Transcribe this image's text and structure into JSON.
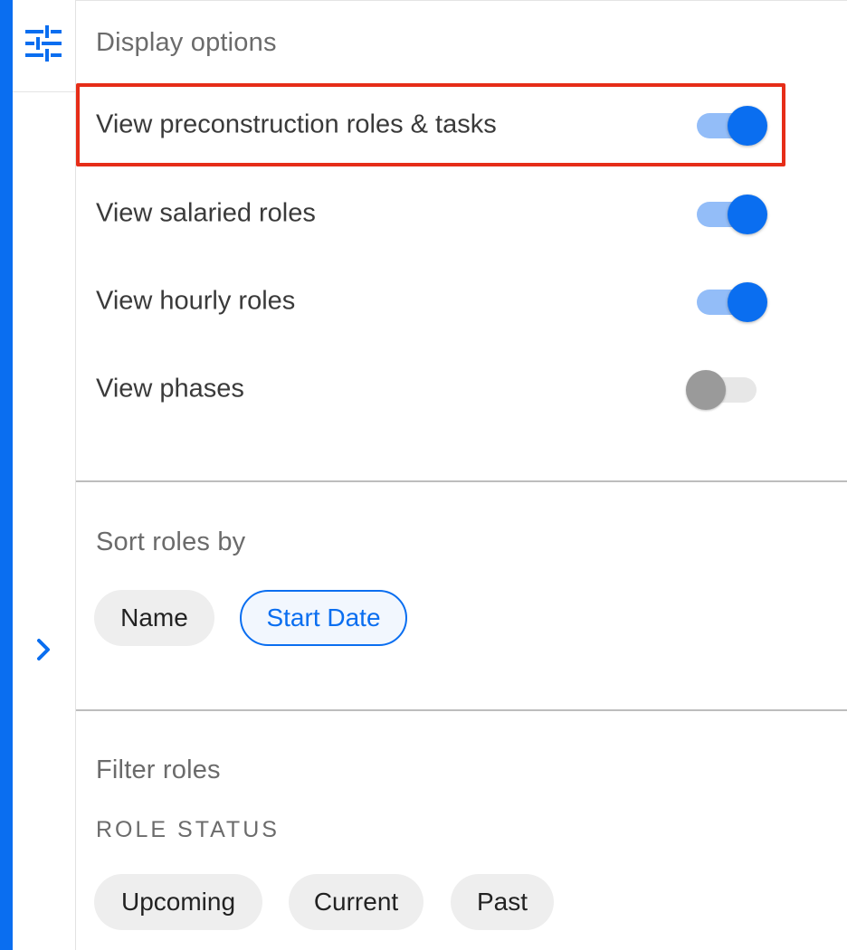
{
  "colors": {
    "accent": "#0a6ef0",
    "highlight_border": "#e62d18",
    "switch_on_track": "#93bdf8",
    "switch_off_thumb": "#9a9a9a",
    "chip_bg": "#eeeeee"
  },
  "rail": {
    "top_icon": "tune-icon",
    "expand_icon": "chevron-right-icon"
  },
  "display_options": {
    "title": "Display options",
    "items": [
      {
        "label": "View preconstruction roles & tasks",
        "on": true,
        "highlighted": true
      },
      {
        "label": "View salaried roles",
        "on": true,
        "highlighted": false
      },
      {
        "label": "View hourly roles",
        "on": true,
        "highlighted": false
      },
      {
        "label": "View phases",
        "on": false,
        "highlighted": false
      }
    ]
  },
  "sort": {
    "title": "Sort roles by",
    "options": [
      {
        "label": "Name",
        "selected": false
      },
      {
        "label": "Start Date",
        "selected": true
      }
    ]
  },
  "filter": {
    "title": "Filter roles",
    "status_heading": "ROLE STATUS",
    "status_options": [
      {
        "label": "Upcoming",
        "selected": false
      },
      {
        "label": "Current",
        "selected": false
      },
      {
        "label": "Past",
        "selected": false
      }
    ]
  }
}
